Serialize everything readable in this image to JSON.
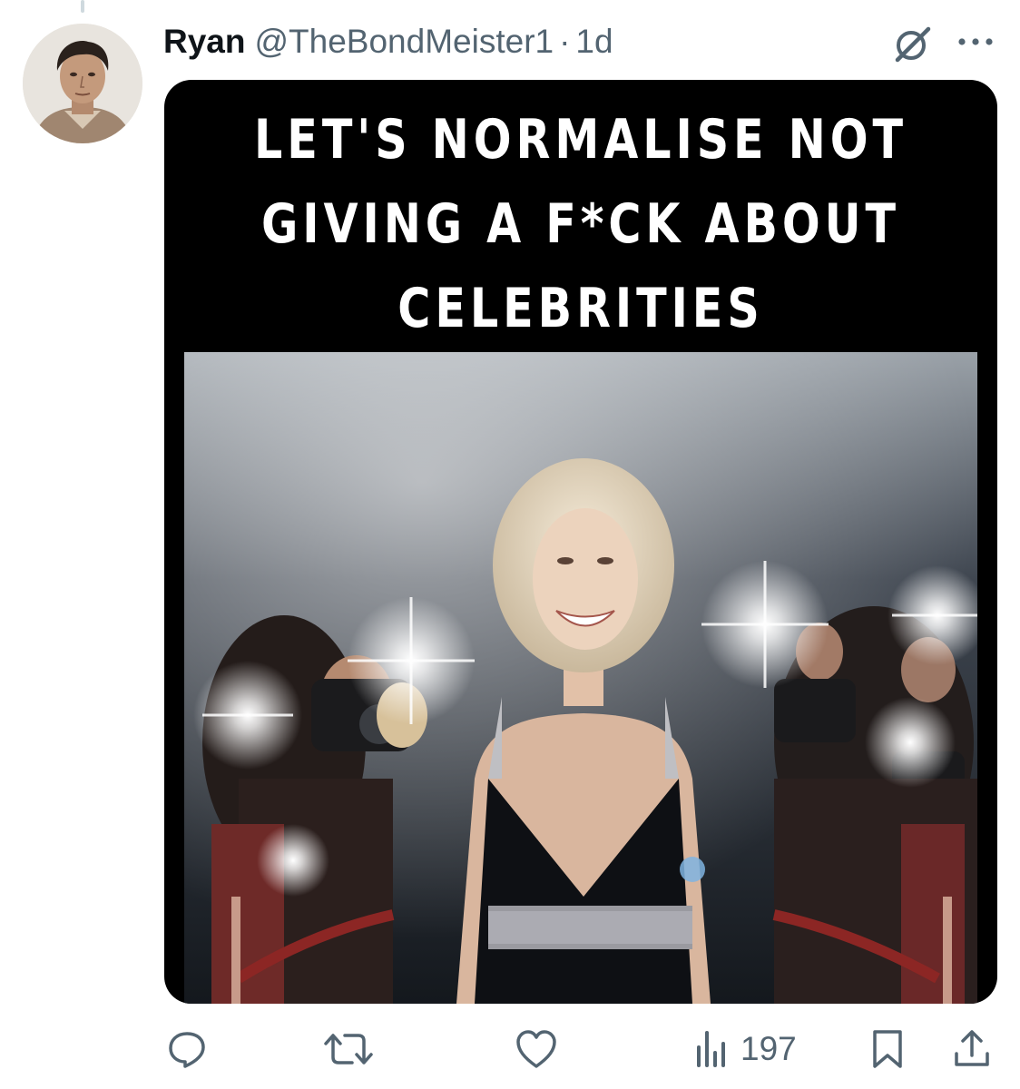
{
  "tweet": {
    "display_name": "Ryan",
    "handle": "@TheBondMeister1",
    "separator": "·",
    "timestamp": "1d"
  },
  "media": {
    "caption_lines": [
      "LET'S NORMALISE NOT",
      "GIVING A F*CK ABOUT",
      "CELEBRITIES"
    ]
  },
  "actions": {
    "reply_icon": "reply-icon",
    "retweet_icon": "retweet-icon",
    "like_icon": "heart-icon",
    "views_icon": "views-icon",
    "views_count": "197",
    "bookmark_icon": "bookmark-icon",
    "share_icon": "share-icon"
  },
  "colors": {
    "text_primary": "#0f1419",
    "text_secondary": "#536471",
    "media_background": "#000000"
  }
}
